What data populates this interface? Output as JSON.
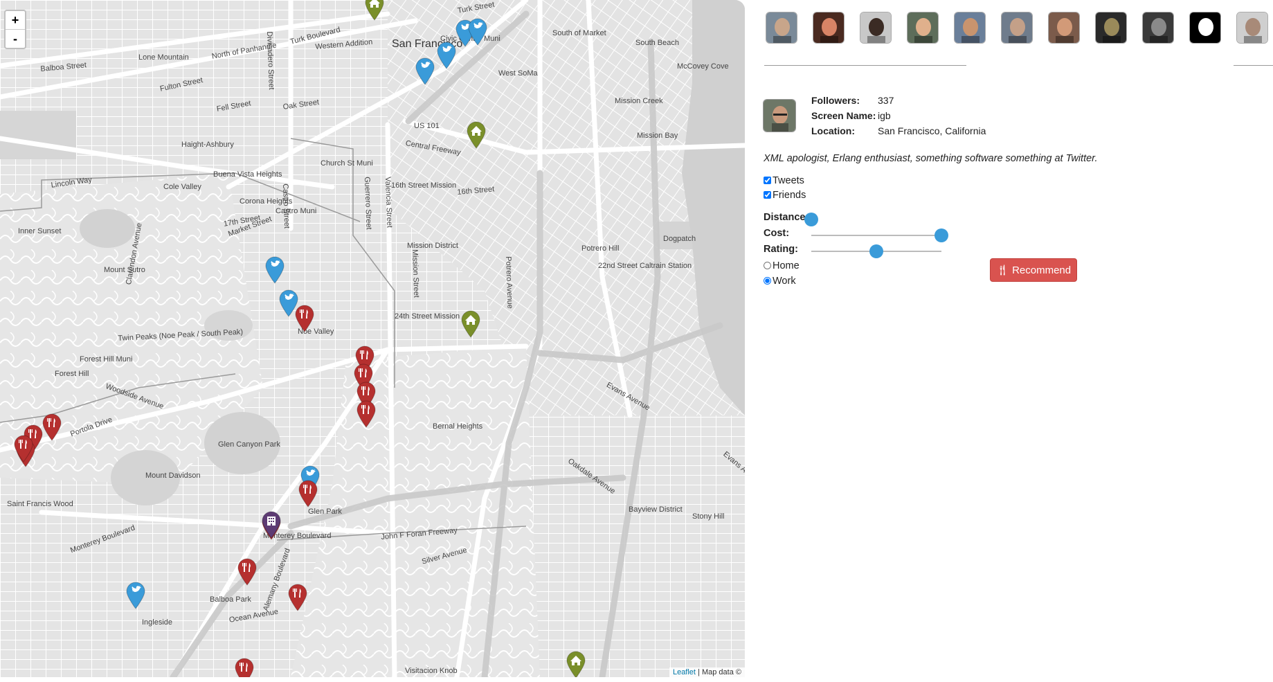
{
  "map": {
    "zoom_in": "+",
    "zoom_out": "-",
    "attribution": {
      "link": "Leaflet",
      "rest": "| Map data ©"
    },
    "labels": [
      {
        "t": "San Francisco",
        "c": "big"
      },
      {
        "t": "Civic Center Muni",
        "c": "mid"
      },
      {
        "t": "Turk Street",
        "c": "mid"
      },
      {
        "t": "Turk Boulevard",
        "c": "mid"
      },
      {
        "t": "Western Addition",
        "c": "mid"
      },
      {
        "t": "North of Panhandle",
        "c": "mid"
      },
      {
        "t": "Lone Mountain",
        "c": "mid"
      },
      {
        "t": "Balboa Street",
        "c": "mid"
      },
      {
        "t": "Fulton Street",
        "c": "mid"
      },
      {
        "t": "Fell Street",
        "c": "mid"
      },
      {
        "t": "Oak Street",
        "c": "mid"
      },
      {
        "t": "Haight-Ashbury",
        "c": "mid"
      },
      {
        "t": "South of Market",
        "c": "mid"
      },
      {
        "t": "South Beach",
        "c": "mid"
      },
      {
        "t": "McCovey Cove",
        "c": "mid"
      },
      {
        "t": "West SoMa",
        "c": "mid"
      },
      {
        "t": "Mission Creek",
        "c": "mid"
      },
      {
        "t": "Mission Bay",
        "c": "mid"
      },
      {
        "t": "US 101",
        "c": "mid"
      },
      {
        "t": "Central Freeway",
        "c": "mid"
      },
      {
        "t": "Church St Muni",
        "c": "mid"
      },
      {
        "t": "Buena Vista Heights",
        "c": "mid"
      },
      {
        "t": "Cole Valley",
        "c": "mid"
      },
      {
        "t": "Lincoln Way",
        "c": "mid"
      },
      {
        "t": "16th Street Mission",
        "c": "mid"
      },
      {
        "t": "16th Street",
        "c": "mid"
      },
      {
        "t": "Corona Heights",
        "c": "mid"
      },
      {
        "t": "Castro Muni",
        "c": "mid"
      },
      {
        "t": "17th Street",
        "c": "mid"
      },
      {
        "t": "Market Street",
        "c": "mid"
      },
      {
        "t": "Inner Sunset",
        "c": "mid"
      },
      {
        "t": "Mission District",
        "c": "mid"
      },
      {
        "t": "Potrero Hill",
        "c": "mid"
      },
      {
        "t": "22nd Street Caltrain Station",
        "c": "mid"
      },
      {
        "t": "Dogpatch",
        "c": "mid"
      },
      {
        "t": "Mount Sutro",
        "c": "mid"
      },
      {
        "t": "24th Street Mission",
        "c": "mid"
      },
      {
        "t": "Noe Valley",
        "c": "mid"
      },
      {
        "t": "Twin Peaks (Noe Peak / South Peak)",
        "c": "mid"
      },
      {
        "t": "Forest Hill Muni",
        "c": "mid"
      },
      {
        "t": "Forest Hill",
        "c": "mid"
      },
      {
        "t": "Woodside Avenue",
        "c": "mid"
      },
      {
        "t": "Portola Drive",
        "c": "mid"
      },
      {
        "t": "Glen Canyon Park",
        "c": "mid"
      },
      {
        "t": "Bernal Heights",
        "c": "mid"
      },
      {
        "t": "Mount Davidson",
        "c": "mid"
      },
      {
        "t": "Saint Francis Wood",
        "c": "mid"
      },
      {
        "t": "Glen Park",
        "c": "mid"
      },
      {
        "t": "Monterey Boulevard",
        "c": "mid"
      },
      {
        "t": "John F Foran Freeway",
        "c": "mid"
      },
      {
        "t": "Silver Avenue",
        "c": "mid"
      },
      {
        "t": "Bayview District",
        "c": "mid"
      },
      {
        "t": "Stony Hill",
        "c": "mid"
      },
      {
        "t": "Oakdale Avenue",
        "c": "mid"
      },
      {
        "t": "Evans Avenue",
        "c": "mid"
      },
      {
        "t": "Balboa Park",
        "c": "mid"
      },
      {
        "t": "Ocean Avenue",
        "c": "mid"
      },
      {
        "t": "Ingleside",
        "c": "mid"
      },
      {
        "t": "Visitacion Knob",
        "c": "mid"
      },
      {
        "t": "Alemany Boulevard",
        "c": "mid"
      },
      {
        "t": "Valencia Street",
        "c": "mid"
      },
      {
        "t": "Guerrero Street",
        "c": "mid"
      },
      {
        "t": "Mission Street",
        "c": "mid"
      },
      {
        "t": "Potrero Avenue",
        "c": "mid"
      },
      {
        "t": "Clarendon Avenue",
        "c": "mid"
      },
      {
        "t": "Monterey Boulevard",
        "c": "mid"
      },
      {
        "t": "Castro Street",
        "c": "mid"
      },
      {
        "t": "Divisadero Street",
        "c": "mid"
      },
      {
        "t": "Evans Avenue",
        "c": "mid"
      }
    ],
    "markers": [
      {
        "type": "home",
        "color": "#7a8f2a"
      },
      {
        "type": "twitter",
        "color": "#3a9bd9"
      },
      {
        "type": "twitter",
        "color": "#3a9bd9"
      },
      {
        "type": "twitter",
        "color": "#3a9bd9"
      },
      {
        "type": "twitter",
        "color": "#3a9bd9"
      },
      {
        "type": "home",
        "color": "#7a8f2a"
      },
      {
        "type": "twitter",
        "color": "#3a9bd9"
      },
      {
        "type": "twitter",
        "color": "#3a9bd9"
      },
      {
        "type": "food",
        "color": "#b5302f"
      },
      {
        "type": "home",
        "color": "#7a8f2a"
      },
      {
        "type": "food",
        "color": "#b5302f"
      },
      {
        "type": "food",
        "color": "#b5302f"
      },
      {
        "type": "food",
        "color": "#b5302f"
      },
      {
        "type": "food",
        "color": "#b5302f"
      },
      {
        "type": "food",
        "color": "#b5302f"
      },
      {
        "type": "food",
        "color": "#b5302f"
      },
      {
        "type": "food",
        "color": "#b5302f"
      },
      {
        "type": "food",
        "color": "#b5302f"
      },
      {
        "type": "twitter",
        "color": "#3a9bd9"
      },
      {
        "type": "food",
        "color": "#b5302f"
      },
      {
        "type": "food",
        "color": "#b5302f"
      },
      {
        "type": "work",
        "color": "#5d3b73"
      },
      {
        "type": "food",
        "color": "#b5302f"
      },
      {
        "type": "twitter",
        "color": "#3a9bd9"
      },
      {
        "type": "food",
        "color": "#b5302f"
      },
      {
        "type": "home",
        "color": "#7a8f2a"
      },
      {
        "type": "food",
        "color": "#b5302f"
      }
    ]
  },
  "avatars": [
    {
      "name": "avatar-1",
      "bg": "#7a8a99",
      "face": "#c8a58a"
    },
    {
      "name": "avatar-2",
      "bg": "#4a2a20",
      "face": "#d88466"
    },
    {
      "name": "avatar-3",
      "bg": "#c8c8c8",
      "face": "#3b2b24"
    },
    {
      "name": "avatar-4",
      "bg": "#5d6d5a",
      "face": "#e0b08c"
    },
    {
      "name": "avatar-5",
      "bg": "#6a7f9a",
      "face": "#c9946e"
    },
    {
      "name": "avatar-6",
      "bg": "#6f7c8c",
      "face": "#c4a088"
    },
    {
      "name": "avatar-7",
      "bg": "#7b5b4b",
      "face": "#d29a78"
    },
    {
      "name": "avatar-8",
      "bg": "#2a2a2a",
      "face": "#9a8a5a"
    },
    {
      "name": "avatar-9",
      "bg": "#3a3a3a",
      "face": "#8a8a8a"
    },
    {
      "name": "avatar-10",
      "bg": "#000000",
      "face": "#ffffff"
    },
    {
      "name": "avatar-11",
      "bg": "#cfcfcf",
      "face": "#a88a78"
    }
  ],
  "profile": {
    "followers_label": "Followers:",
    "followers_value": "337",
    "screen_name_label": "Screen Name:",
    "screen_name_value": "igb",
    "location_label": "Location:",
    "location_value": "San Francisco, California",
    "bio": "XML apologist, Erlang enthusiast, something software something at Twitter."
  },
  "filters": {
    "tweets_label": "Tweets",
    "tweets_checked": true,
    "friends_label": "Friends",
    "friends_checked": true,
    "distance_label": "Distance",
    "distance_value": 0,
    "cost_label": "Cost:",
    "cost_value": 1,
    "rating_label": "Rating:",
    "rating_value": 0.5,
    "home_label": "Home",
    "work_label": "Work",
    "location_selected": "Work"
  },
  "recommend_button": "Recommend",
  "colors": {
    "accent": "#3a9bd9",
    "button": "#d9534f",
    "food_marker": "#b5302f",
    "twitter_marker": "#3a9bd9",
    "home_marker": "#7a8f2a",
    "work_marker": "#5d3b73"
  }
}
